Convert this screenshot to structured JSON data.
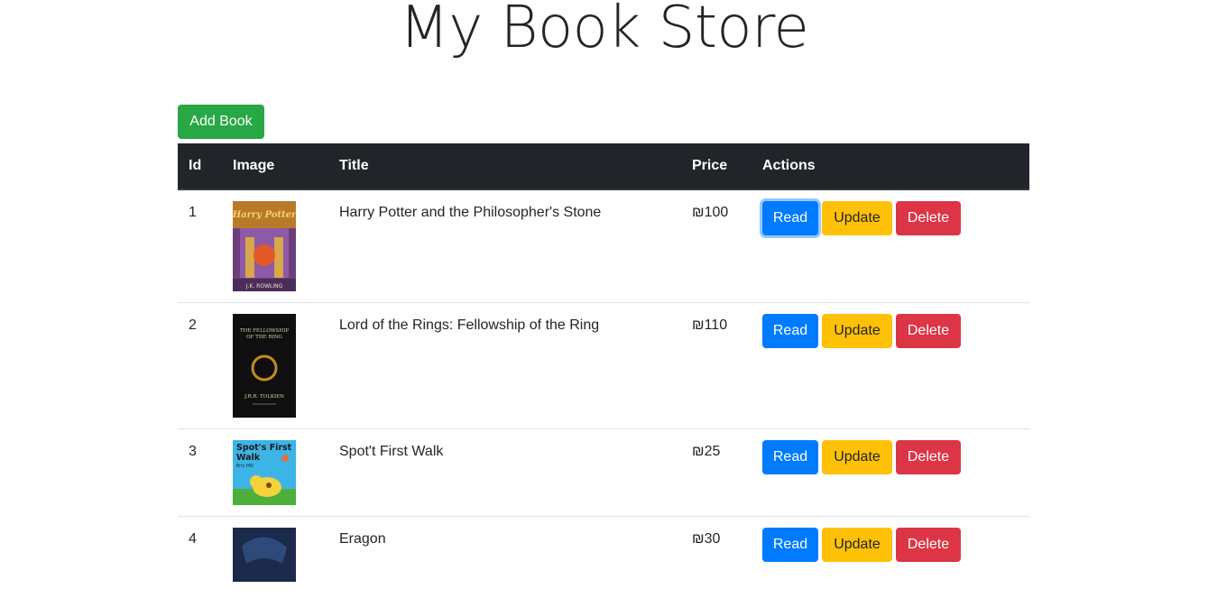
{
  "header": {
    "title": "My Book Store"
  },
  "toolbar": {
    "add_label": "Add Book"
  },
  "table": {
    "columns": [
      "Id",
      "Image",
      "Title",
      "Price",
      "Actions"
    ],
    "rows": [
      {
        "id": "1",
        "title": "Harry Potter and the Philosopher's Stone",
        "price": "₪100",
        "cover_text": "Harry Potter",
        "cover_author": "J.K. ROWLING"
      },
      {
        "id": "2",
        "title": "Lord of the Rings: Fellowship of the Ring",
        "price": "₪110",
        "cover_text": "THE FELLOWSHIP OF THE RING",
        "cover_author": "J.R.R. TOLKIEN"
      },
      {
        "id": "3",
        "title": "Spot't First Walk",
        "price": "₪25",
        "cover_text": "Spot's First Walk",
        "cover_author": "Eric Hill"
      },
      {
        "id": "4",
        "title": "Eragon",
        "price": "₪30",
        "cover_text": "",
        "cover_author": ""
      }
    ],
    "actions": {
      "read": "Read",
      "update": "Update",
      "delete": "Delete"
    }
  },
  "colors": {
    "add": "#28a745",
    "read": "#007bff",
    "update": "#ffc107",
    "delete": "#dc3545",
    "header_bg": "#212529"
  }
}
